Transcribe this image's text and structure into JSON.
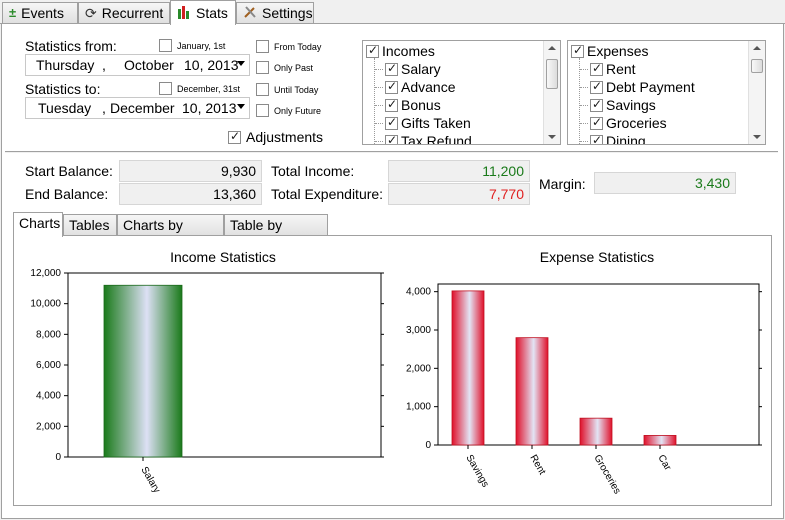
{
  "tabs": [
    {
      "label": "Events",
      "icon": "plus-minus-icon"
    },
    {
      "label": "Recurrent",
      "icon": "refresh-icon"
    },
    {
      "label": "Stats",
      "icon": "bar-chart-icon"
    },
    {
      "label": "Settings",
      "icon": "tools-icon"
    }
  ],
  "active_tab": "Stats",
  "filters": {
    "from_label": "Statistics from:",
    "from_date": {
      "weekday": "Thursday",
      "sep": ",",
      "month": "October",
      "day_year": "10, 2013"
    },
    "to_label": "Statistics to:",
    "to_date": {
      "weekday": "Tuesday",
      "sep": ",",
      "month": "December",
      "day_year": "10, 2013"
    },
    "jan1_label": "January, 1st",
    "dec31_label": "December, 31st",
    "from_today_label": "From Today",
    "only_past_label": "Only Past",
    "until_today_label": "Until Today",
    "only_future_label": "Only Future",
    "adjustments_label": "Adjustments",
    "adjustments_checked": true
  },
  "incomes_tree": {
    "root": "Incomes",
    "items": [
      "Salary",
      "Advance",
      "Bonus",
      "Gifts Taken",
      "Tax Refund"
    ]
  },
  "expenses_tree": {
    "root": "Expenses",
    "items": [
      "Rent",
      "Debt Payment",
      "Savings",
      "Groceries",
      "Dining"
    ]
  },
  "summary": {
    "start_balance_label": "Start Balance:",
    "start_balance": "9,930",
    "end_balance_label": "End Balance:",
    "end_balance": "13,360",
    "total_income_label": "Total Income:",
    "total_income": "11,200",
    "total_expenditure_label": "Total Expenditure:",
    "total_expenditure": "7,770",
    "margin_label": "Margin:",
    "margin": "3,430",
    "colors": {
      "positive": "#1a7a1a",
      "negative": "#e02020"
    }
  },
  "subtabs": [
    "Charts",
    "Tables",
    "Charts by Month",
    "Table by Month"
  ],
  "active_subtab": "Charts",
  "chart_data": [
    {
      "type": "bar",
      "title": "Income Statistics",
      "categories": [
        "Salary"
      ],
      "values": [
        11200
      ],
      "ylim": [
        0,
        12000
      ],
      "yticks": [
        "0",
        "2,000",
        "4,000",
        "6,000",
        "8,000",
        "10,000",
        "12,000"
      ],
      "xlabel": "",
      "ylabel": "",
      "color": "#1a8a1a",
      "grid": false
    },
    {
      "type": "bar",
      "title": "Expense Statistics",
      "categories": [
        "Savings",
        "Rent",
        "Groceries",
        "Car"
      ],
      "values": [
        4020,
        2800,
        700,
        250
      ],
      "ylim": [
        0,
        4200
      ],
      "yticks": [
        "0",
        "1,000",
        "2,000",
        "3,000",
        "4,000"
      ],
      "xlabel": "",
      "ylabel": "",
      "color": "#e02030",
      "grid": false
    }
  ]
}
